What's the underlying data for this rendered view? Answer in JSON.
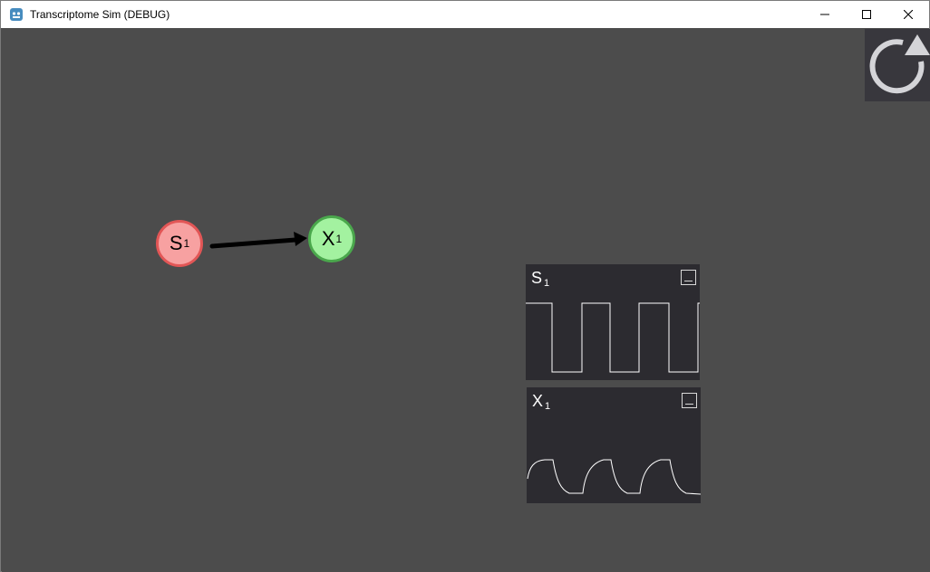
{
  "window": {
    "title": "Transcriptome Sim (DEBUG)",
    "controls": [
      "minimize",
      "maximize",
      "close"
    ]
  },
  "toolbar": {
    "reset_icon": "reset-icon"
  },
  "graph": {
    "nodes": [
      {
        "id": "S",
        "label": "S",
        "subscript": "1",
        "color": "#f7a1a1",
        "border": "#e25656"
      },
      {
        "id": "X",
        "label": "X",
        "subscript": "1",
        "color": "#a3f2a0",
        "border": "#4aa84c"
      }
    ],
    "edges": [
      {
        "from": "S",
        "to": "X"
      }
    ]
  },
  "plots": [
    {
      "label": "S",
      "subscript": "1",
      "waveform": "square"
    },
    {
      "label": "X",
      "subscript": "1",
      "waveform": "charge-discharge"
    }
  ]
}
